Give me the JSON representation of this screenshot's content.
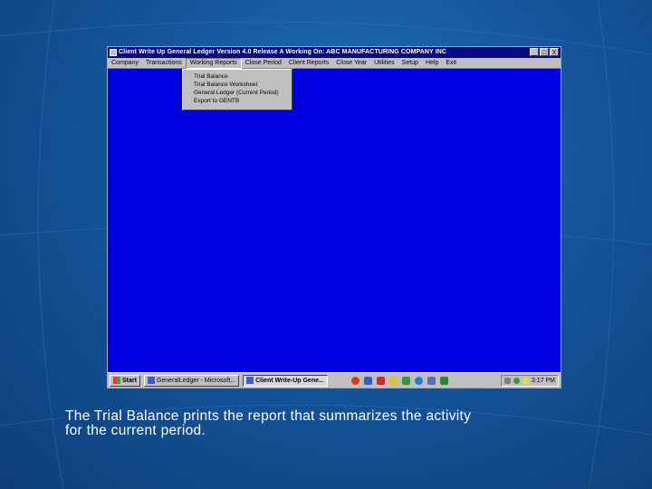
{
  "window": {
    "title": "Client Write Up General Ledger   Version 4.0 Release A     Working On:  ABC MANUFACTURING COMPANY INC",
    "buttons": [
      "_",
      "□",
      "X"
    ]
  },
  "menu": {
    "items": [
      "Company",
      "Transactions",
      "Working Reports",
      "Close Period",
      "Client Reports",
      "Close Year",
      "Utilities",
      "Setup",
      "Help",
      "Exit"
    ],
    "open_index": 2
  },
  "dropdown": {
    "items": [
      "Trial Balance",
      "Trial Balance Worksheet",
      "General Ledger (Current Period)",
      "Export to GENTB"
    ]
  },
  "taskbar": {
    "start": "Start",
    "tasks": [
      "GeneralLedger - Microsoft...",
      "Client Write-Up Gene..."
    ],
    "clock": "3:17 PM"
  },
  "caption": {
    "line1": "The Trial Balance prints the report that summarizes the activity",
    "line2": "for the current period."
  },
  "colors": {
    "app_background": "#0000e0",
    "title_bar": "#0a0a80",
    "slide_background": "#15559a"
  }
}
